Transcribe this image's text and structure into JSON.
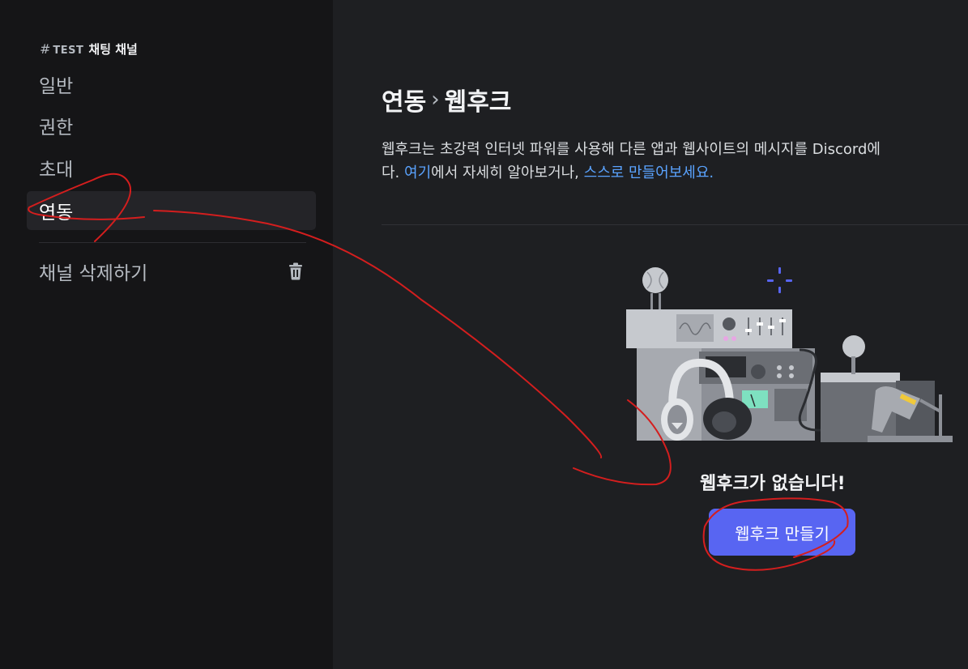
{
  "sidebar": {
    "header": {
      "hash": "#",
      "category": "TEST",
      "channel": "채팅 채널"
    },
    "items": [
      {
        "label": "일반",
        "active": false
      },
      {
        "label": "권한",
        "active": false
      },
      {
        "label": "초대",
        "active": false
      },
      {
        "label": "연동",
        "active": true
      }
    ],
    "delete_label": "채널 삭제하기"
  },
  "main": {
    "breadcrumb": {
      "parent": "연동",
      "separator": "›",
      "current": "웹후크"
    },
    "description": {
      "line1": "웹후크는 초강력 인터넷 파워를 사용해 다른 앱과 웹사이트의 메시지를 Discord에",
      "line2_start": "다. ",
      "link1": "여기",
      "line2_mid": "에서 자세히 알아보거나, ",
      "link2": "스스로 만들어보세요."
    },
    "empty_state": {
      "title": "웹후크가 없습니다!",
      "button_label": "웹후크 만들기"
    }
  },
  "colors": {
    "sidebar_bg": "#151517",
    "main_bg": "#1e1f22",
    "active_item_bg": "#242428",
    "link": "#5aa3ff",
    "brand_button": "#5865f2",
    "annotation": "#d41e1e"
  },
  "icons": [
    "trash-icon",
    "webhook-illustration"
  ]
}
